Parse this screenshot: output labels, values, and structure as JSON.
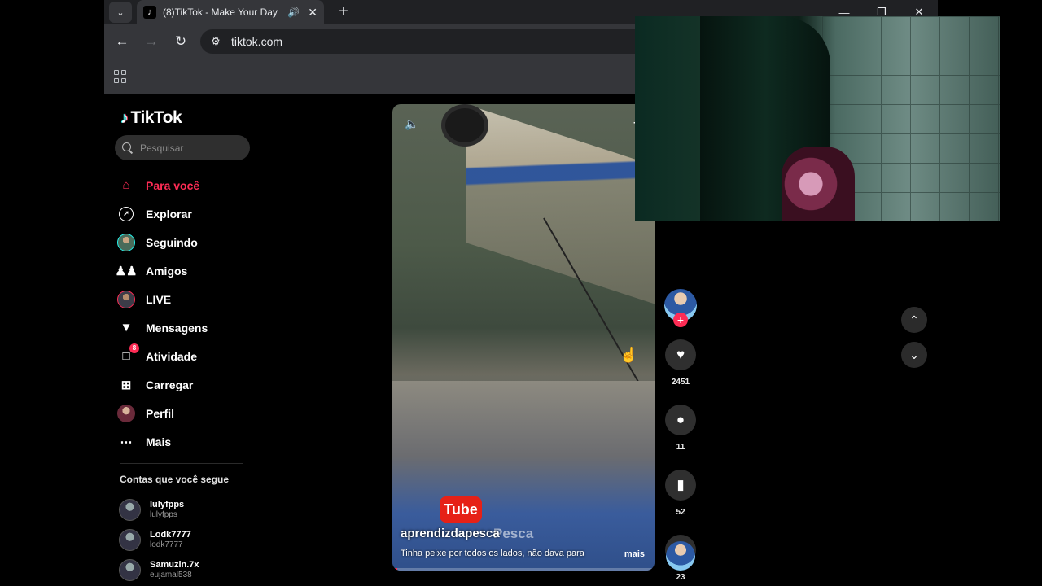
{
  "browser": {
    "tab": {
      "title": "(8)TikTok - Make Your Day",
      "favicon": "tiktok-icon",
      "audio_icon": "speaker-icon"
    },
    "url": "tiktok.com"
  },
  "sidebar": {
    "logo": "TikTok",
    "search_placeholder": "Pesquisar",
    "nav": [
      {
        "label": "Para você",
        "icon": "home-icon",
        "active": true
      },
      {
        "label": "Explorar",
        "icon": "compass-icon"
      },
      {
        "label": "Seguindo",
        "icon": "avatar"
      },
      {
        "label": "Amigos",
        "icon": "friends-icon"
      },
      {
        "label": "LIVE",
        "icon": "avatar"
      },
      {
        "label": "Mensagens",
        "icon": "send-icon"
      },
      {
        "label": "Atividade",
        "icon": "inbox-icon",
        "badge": "8"
      },
      {
        "label": "Carregar",
        "icon": "upload-icon"
      },
      {
        "label": "Perfil",
        "icon": "avatar"
      },
      {
        "label": "Mais",
        "icon": "more-icon"
      }
    ],
    "following_title": "Contas que você segue",
    "accounts": [
      {
        "name": "lulyfpps",
        "handle": "lulyfpps"
      },
      {
        "name": "Lodk7777",
        "handle": "lodk7777"
      },
      {
        "name": "Samuzin.7x",
        "handle": "eujamal538"
      }
    ]
  },
  "video": {
    "username": "aprendizdapesca",
    "watermark": "Pesca",
    "yt_label": "Tube",
    "description": "Tinha peixe por todos os lados, não dava para",
    "more": "mais",
    "progress": 0.02
  },
  "actions": {
    "likes": "2451",
    "comments": "11",
    "saves": "52",
    "shares": "23"
  },
  "colors": {
    "accent": "#fe2c55",
    "cyan": "#25f4ee",
    "chrome_dark": "#202124",
    "chrome": "#35363a"
  }
}
